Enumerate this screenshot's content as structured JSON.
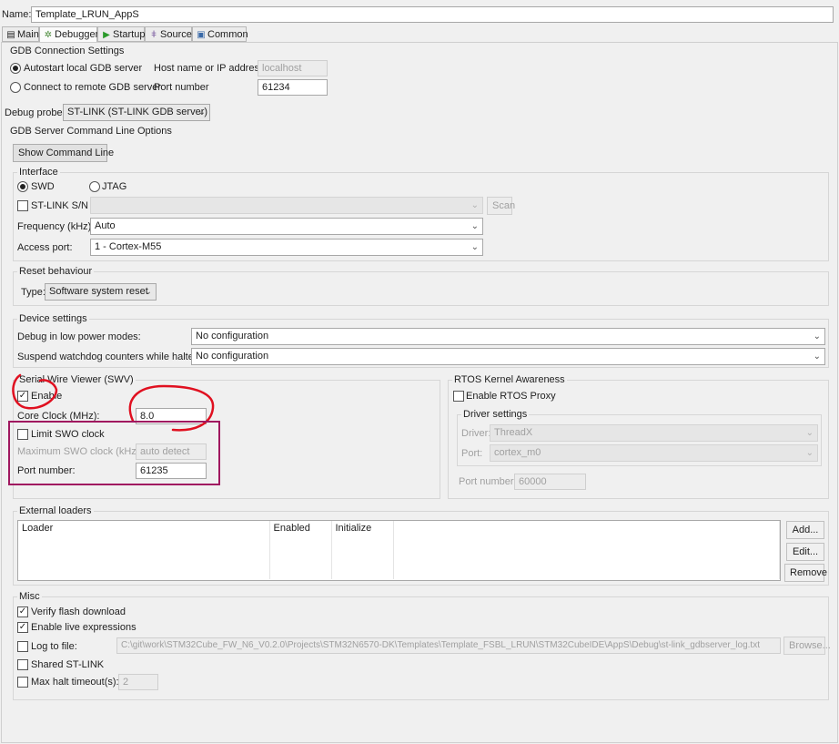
{
  "name_label": "Name:",
  "name_value": "Template_LRUN_AppS",
  "tabs": [
    {
      "label": "Main",
      "icon": "document-icon"
    },
    {
      "label": "Debugger",
      "icon": "debugger-icon"
    },
    {
      "label": "Startup",
      "icon": "play-icon"
    },
    {
      "label": "Source",
      "icon": "source-icon"
    },
    {
      "label": "Common",
      "icon": "common-icon"
    }
  ],
  "gdb": {
    "title": "GDB Connection Settings",
    "autostart_label": "Autostart local GDB server",
    "remote_label": "Connect to remote GDB server",
    "host_label": "Host name or IP address",
    "host_value": "localhost",
    "port_label": "Port number",
    "port_value": "61234"
  },
  "probe": {
    "label": "Debug probe",
    "value": "ST-LINK (ST-LINK GDB server)"
  },
  "server_options": {
    "title": "GDB Server Command Line Options",
    "show_cmd_label": "Show Command Line"
  },
  "interface": {
    "title": "Interface",
    "swd_label": "SWD",
    "jtag_label": "JTAG",
    "stlink_sn_label": "ST-LINK S/N",
    "scan_label": "Scan",
    "freq_label": "Frequency (kHz):",
    "freq_value": "Auto",
    "access_label": "Access port:",
    "access_value": "1 - Cortex-M55"
  },
  "reset": {
    "title": "Reset behaviour",
    "type_label": "Type:",
    "type_value": "Software system reset"
  },
  "device": {
    "title": "Device settings",
    "lowpower_label": "Debug in low power modes:",
    "lowpower_value": "No configuration",
    "watchdog_label": "Suspend watchdog counters while halted:",
    "watchdog_value": "No configuration"
  },
  "swv": {
    "title": "Serial Wire Viewer (SWV)",
    "enable_label": "Enable",
    "core_clock_label": "Core Clock (MHz):",
    "core_clock_value": "8.0",
    "limit_label": "Limit SWO clock",
    "max_label": "Maximum SWO clock (kHz):",
    "max_value": "auto detect",
    "port_label": "Port number:",
    "port_value": "61235"
  },
  "rtos": {
    "title": "RTOS Kernel Awareness",
    "enable_label": "Enable RTOS Proxy",
    "driver_settings": "Driver settings",
    "driver_label": "Driver:",
    "driver_value": "ThreadX",
    "port_label": "Port:",
    "port_value": "cortex_m0",
    "portnum_label": "Port number:",
    "portnum_value": "60000"
  },
  "loaders": {
    "title": "External loaders",
    "columns": [
      "Loader",
      "Enabled",
      "Initialize"
    ],
    "add_label": "Add...",
    "edit_label": "Edit...",
    "remove_label": "Remove"
  },
  "misc": {
    "title": "Misc",
    "verify_label": "Verify flash download",
    "live_label": "Enable live expressions",
    "log_label": "Log to file:",
    "log_value": "C:\\git\\work\\STM32Cube_FW_N6_V0.2.0\\Projects\\STM32N6570-DK\\Templates\\Template_FSBL_LRUN\\STM32CubeIDE\\AppS\\Debug\\st-link_gdbserver_log.txt",
    "browse_label": "Browse...",
    "shared_label": "Shared ST-LINK",
    "halt_label": "Max halt timeout(s):",
    "halt_value": "2"
  },
  "glyphs": {
    "check": "✓",
    "chevron": "⌄",
    "play": "▶"
  },
  "colors": {
    "annotation_red": "#e01020",
    "annotation_box": "#a01860"
  }
}
